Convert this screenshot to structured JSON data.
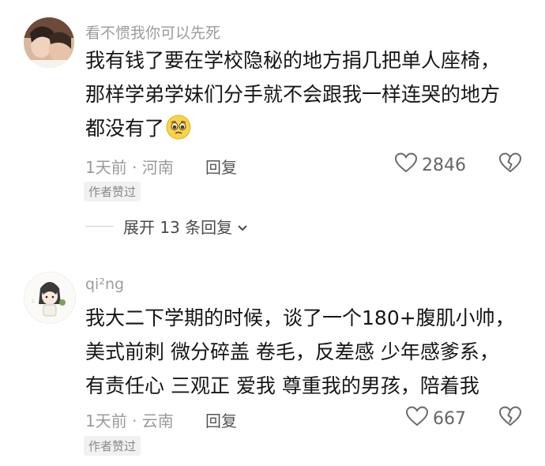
{
  "comments": [
    {
      "username": "看不惯我你可以先死",
      "lines": [
        "我有钱了要在学校隐秘的地方捐几把单人座椅，",
        "那样学弟学妹们分手就不会跟我一样连哭的地方",
        "都没有了"
      ],
      "emoji": "pleading-face-emoji",
      "time_location": "1天前 · 河南",
      "reply_label": "回复",
      "likes": "2846",
      "badge": "作者赞过",
      "expand_label": "展开 13 条回复"
    },
    {
      "username": "qi²ng",
      "lines": [
        "我大二下学期的时候，谈了一个180+腹肌小帅，",
        "美式前刺 微分碎盖 卷毛，反差感 少年感爹系，",
        "有责任心 三观正 爱我 尊重我的男孩，陪着我"
      ],
      "time_location": "1天前 · 云南",
      "reply_label": "回复",
      "likes": "667",
      "badge": "作者赞过"
    }
  ],
  "icons": {
    "like": "heart-outline-icon",
    "dislike": "broken-heart-icon",
    "expand": "chevron-down-icon"
  },
  "colors": {
    "text": "#161616",
    "meta": "#9a9a9a",
    "badge_bg": "#f1f1f1"
  }
}
